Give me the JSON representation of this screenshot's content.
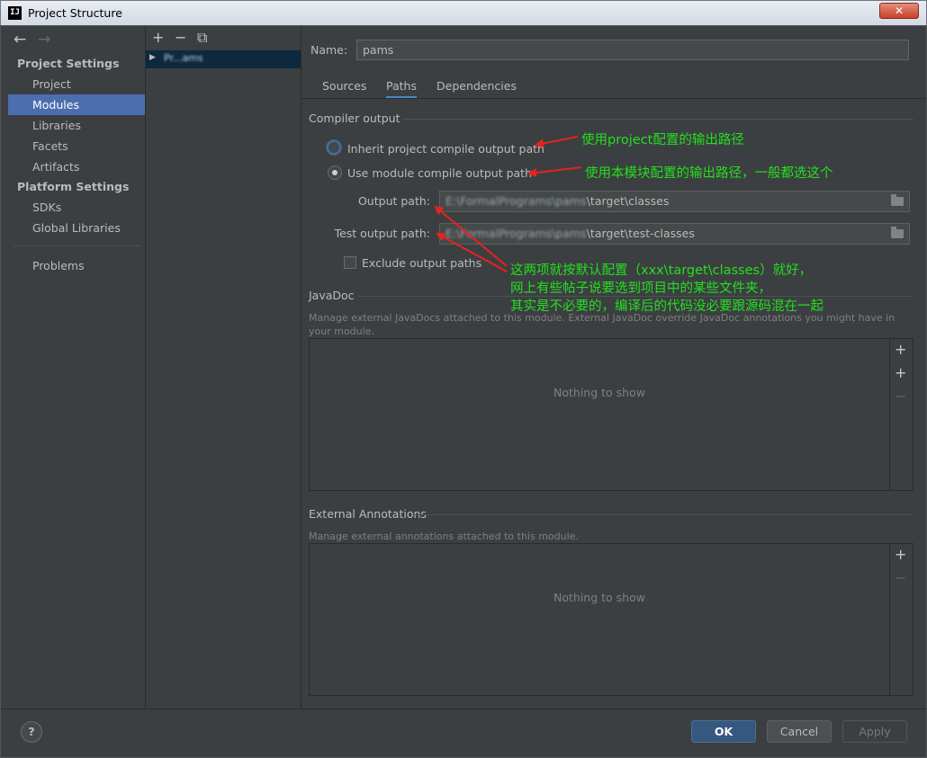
{
  "window": {
    "title": "Project Structure",
    "close_label": "✕",
    "app_icon": "IJ"
  },
  "sidebar": {
    "back_icon": "←",
    "forward_icon": "→",
    "sections": [
      {
        "title": "Project Settings",
        "items": [
          "Project",
          "Modules",
          "Libraries",
          "Facets",
          "Artifacts"
        ]
      },
      {
        "title": "Platform Settings",
        "items": [
          "SDKs",
          "Global Libraries"
        ]
      }
    ],
    "selected": "Modules",
    "problems": "Problems"
  },
  "modules": {
    "toolbar": {
      "add": "+",
      "remove": "−",
      "copy": "⧉"
    },
    "items": [
      "Pr...ams"
    ]
  },
  "content": {
    "name_label": "Name:",
    "name_value": "pams",
    "tabs": [
      "Sources",
      "Paths",
      "Dependencies"
    ],
    "active_tab": "Paths",
    "compiler_output": {
      "title": "Compiler output",
      "inherit_label": "Inherit project compile output path",
      "use_module_label": "Use module compile output path",
      "output_path_label": "Output path:",
      "output_path_prefix": "E:\\FormalPrograms\\pams",
      "output_path_suffix": "\\target\\classes",
      "test_output_path_label": "Test output path:",
      "test_output_path_prefix": "E:\\FormalPrograms\\pams",
      "test_output_path_suffix": "\\target\\test-classes",
      "exclude_label": "Exclude output paths"
    },
    "javadoc": {
      "title": "JavaDoc",
      "description": "Manage external JavaDocs attached to this module. External JavaDoc override JavaDoc annotations you might have in your module.",
      "empty_text": "Nothing to show",
      "tools": [
        "+",
        "+",
        "−"
      ]
    },
    "external_annotations": {
      "title": "External Annotations",
      "description": "Manage external annotations attached to this module.",
      "empty_text": "Nothing to show",
      "tools": [
        "+",
        "−"
      ]
    }
  },
  "footer": {
    "help_label": "?",
    "ok_label": "OK",
    "cancel_label": "Cancel",
    "apply_label": "Apply"
  },
  "annotations": {
    "inherit_note": "使用project配置的输出路径",
    "module_note": "使用本模块配置的输出路径，一般都选这个",
    "paths_note_line1": "这两项就按默认配置（xxx\\target\\classes）就好，",
    "paths_note_line2": "网上有些帖子说要选到项目中的某些文件夹，",
    "paths_note_line3": "其实是不必要的，编译后的代码没必要跟源码混在一起",
    "arrow_color": "#e8231b",
    "text_color": "#22e01e"
  }
}
